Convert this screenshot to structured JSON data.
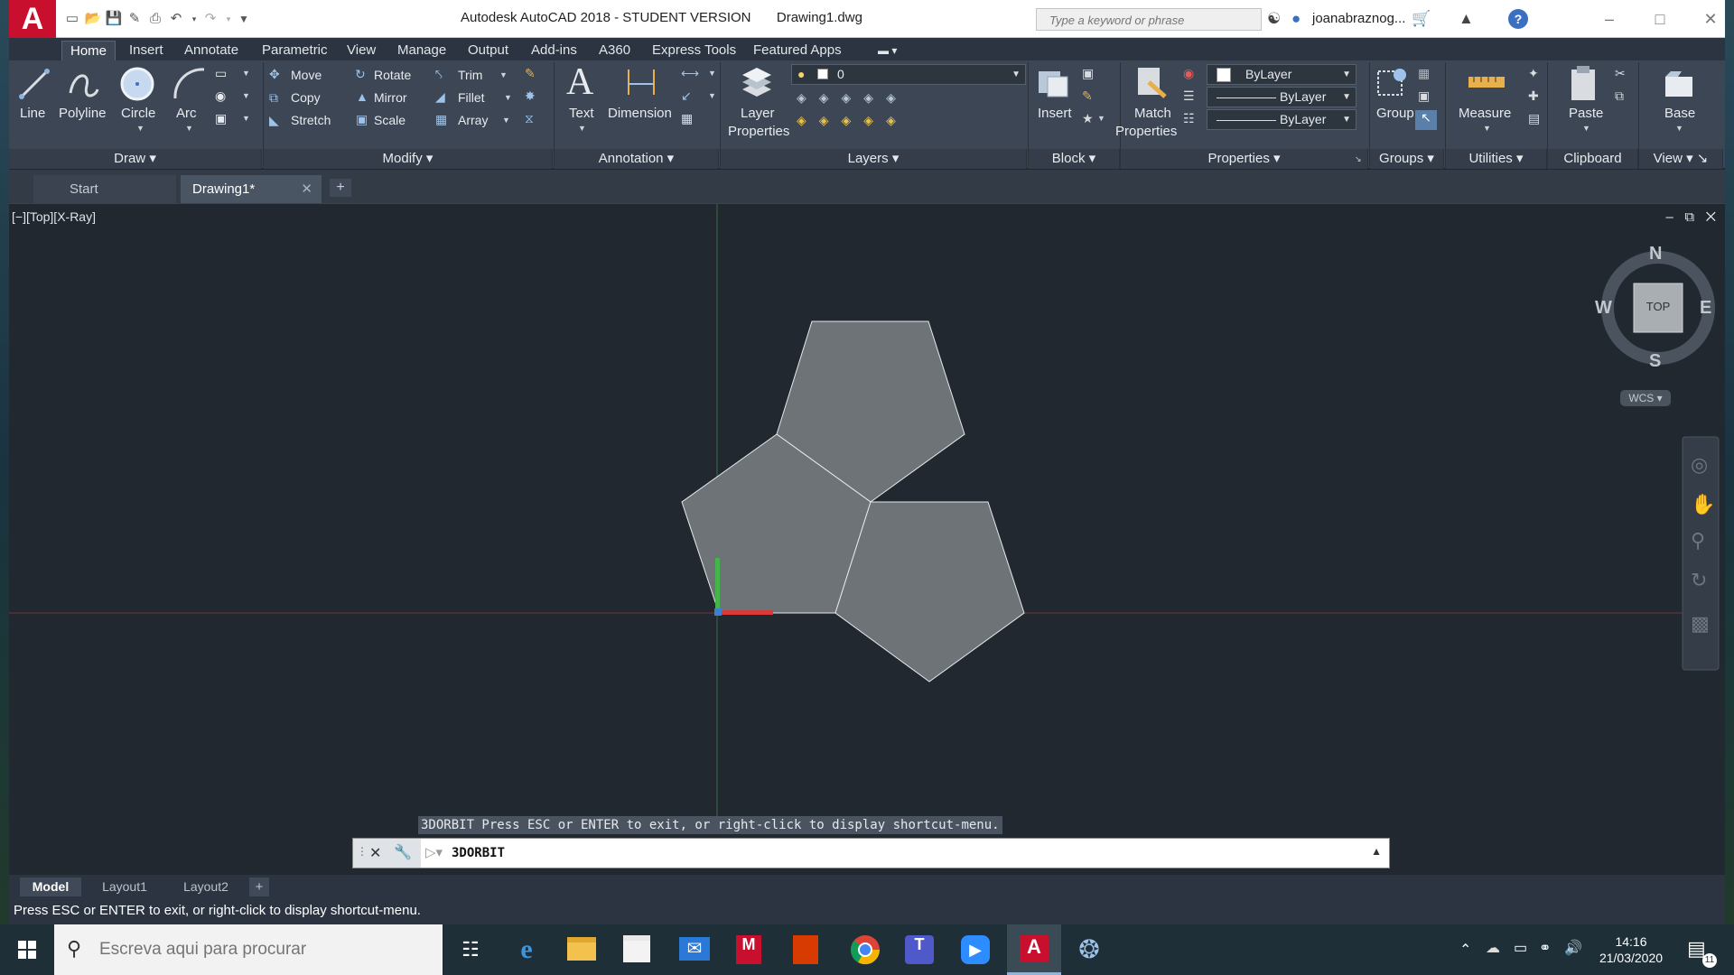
{
  "window": {
    "title": "Autodesk AutoCAD 2018 - STUDENT VERSION",
    "document": "Drawing1.dwg",
    "app_letter": "A",
    "search_placeholder": "Type a keyword or phrase",
    "user": "joanabraznog...",
    "help": "?"
  },
  "ribbon_tabs": [
    "Home",
    "Insert",
    "Annotate",
    "Parametric",
    "View",
    "Manage",
    "Output",
    "Add-ins",
    "A360",
    "Express Tools",
    "Featured Apps"
  ],
  "draw": {
    "line": "Line",
    "polyline": "Polyline",
    "circle": "Circle",
    "arc": "Arc",
    "title": "Draw"
  },
  "modify": {
    "move": "Move",
    "rotate": "Rotate",
    "trim": "Trim",
    "copy": "Copy",
    "mirror": "Mirror",
    "fillet": "Fillet",
    "stretch": "Stretch",
    "scale": "Scale",
    "array": "Array",
    "title": "Modify"
  },
  "annotation": {
    "text": "Text",
    "dimension": "Dimension",
    "title": "Annotation"
  },
  "layers": {
    "layer_properties_1": "Layer",
    "layer_properties_2": "Properties",
    "current_layer": "0",
    "title": "Layers"
  },
  "block": {
    "insert": "Insert",
    "title": "Block"
  },
  "properties": {
    "match_1": "Match",
    "match_2": "Properties",
    "color": "ByLayer",
    "linetype": "ByLayer",
    "lineweight": "ByLayer",
    "title": "Properties"
  },
  "groups": {
    "group": "Group",
    "title": "Groups"
  },
  "utilities": {
    "measure": "Measure",
    "title": "Utilities"
  },
  "clipboard": {
    "paste": "Paste",
    "title": "Clipboard"
  },
  "view_panel": {
    "base": "Base",
    "title": "View"
  },
  "file_tabs": {
    "start": "Start",
    "drawing": "Drawing1*"
  },
  "viewport": {
    "label": "[−][Top][X-Ray]",
    "compass": {
      "n": "N",
      "s": "S",
      "e": "E",
      "w": "W",
      "top": "TOP",
      "wcs": "WCS"
    },
    "shapes": [
      {
        "name": "pentagon-top"
      },
      {
        "name": "pentagon-left"
      },
      {
        "name": "pentagon-right"
      }
    ]
  },
  "command": {
    "history": "3DORBIT Press ESC or ENTER to exit, or right-click to display shortcut-menu.",
    "input": "3DORBIT"
  },
  "layout_tabs": [
    "Model",
    "Layout1",
    "Layout2"
  ],
  "status_text": "Press ESC or ENTER to exit, or right-click to display shortcut-menu.",
  "taskbar": {
    "search_placeholder": "Escreva aqui para procurar",
    "time": "14:16",
    "date": "21/03/2020",
    "notifications": "11"
  },
  "colors": {
    "background": "#212830",
    "shape_fill": "#6e7378",
    "ribbon": "#3c4654",
    "accent": "#c8102e",
    "x_axis": "#d83a3a",
    "y_axis": "#43b54b"
  }
}
